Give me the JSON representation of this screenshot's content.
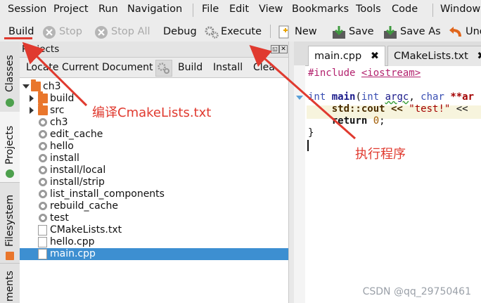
{
  "menubar": {
    "items": [
      "Session",
      "Project",
      "Run",
      "Navigation",
      "File",
      "Edit",
      "View",
      "Bookmarks",
      "Tools",
      "Code",
      "Window"
    ]
  },
  "toolbar": {
    "build": "Build",
    "stop": "Stop",
    "stop_all": "Stop All",
    "debug": "Debug",
    "execute": "Execute",
    "new": "New",
    "save": "Save",
    "save_as": "Save As",
    "undo": "Und"
  },
  "sidetabs": [
    "Classes",
    "Projects",
    "Filesystem",
    "ments"
  ],
  "projects": {
    "title": "Projects",
    "toolbar": [
      "Locate Current Document",
      "Build",
      "Install",
      "Clea"
    ],
    "tree": [
      {
        "label": "ch3",
        "icon": "folder",
        "arrow": "down",
        "indent": 0
      },
      {
        "label": "build",
        "icon": "folder",
        "arrow": "right",
        "indent": 1
      },
      {
        "label": "src",
        "icon": "folder",
        "arrow": "right",
        "indent": 1
      },
      {
        "label": "ch3",
        "icon": "gear",
        "indent": 1
      },
      {
        "label": "edit_cache",
        "icon": "gear",
        "indent": 1
      },
      {
        "label": "hello",
        "icon": "gear",
        "indent": 1
      },
      {
        "label": "install",
        "icon": "gear",
        "indent": 1
      },
      {
        "label": "install/local",
        "icon": "gear",
        "indent": 1
      },
      {
        "label": "install/strip",
        "icon": "gear",
        "indent": 1
      },
      {
        "label": "list_install_components",
        "icon": "gear",
        "indent": 1
      },
      {
        "label": "rebuild_cache",
        "icon": "gear",
        "indent": 1
      },
      {
        "label": "test",
        "icon": "gear",
        "indent": 1
      },
      {
        "label": "CMakeLists.txt",
        "icon": "doc",
        "indent": 1
      },
      {
        "label": "hello.cpp",
        "icon": "doc",
        "indent": 1
      },
      {
        "label": "main.cpp",
        "icon": "doc",
        "indent": 1,
        "selected": true
      }
    ]
  },
  "editor": {
    "tabs": [
      "main.cpp",
      "CMakeLists.txt"
    ],
    "code": {
      "l1a": "#include ",
      "l1b": "<iostream>",
      "l2a": "int ",
      "l2b": "main",
      "l2c": "(",
      "l2d": "int ",
      "l2e": "argc",
      "l2f": ", ",
      "l2g": "char ",
      "l2h": "**ar",
      "l3a": "    std::cout << ",
      "l3b": "\"test!\"",
      "l3c": " <<",
      "l4a": "    return ",
      "l4b": "0",
      "l4c": ";",
      "l5": "}"
    }
  },
  "annotations": {
    "build_note": "编译CmakeLists.txt",
    "execute_note": "执行程序",
    "color": "#e03a2f"
  },
  "watermark": "CSDN @qq_29750461"
}
